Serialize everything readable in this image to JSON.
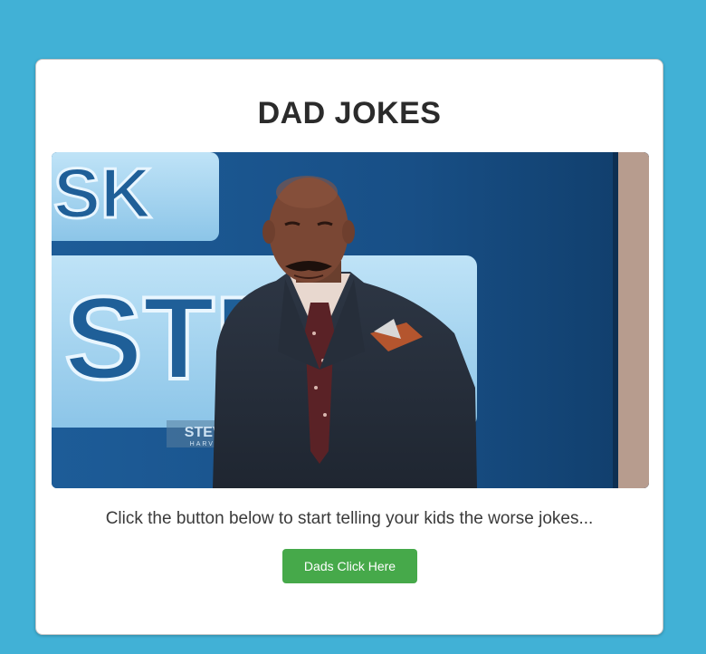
{
  "card": {
    "title": "DAD JOKES",
    "gif": {
      "alt": "Steve Harvey looking down with a grimace on the set of Ask Steve",
      "backdrop_letters_top": "SK",
      "backdrop_letters_middle": "STE",
      "show_logo_main": "STEVE",
      "show_logo_sub": "HARVEY"
    },
    "caption": "Click the button below to start telling your kids the worse jokes...",
    "button_label": "Dads Click Here"
  },
  "colors": {
    "page_background": "#41b1d6",
    "button": "#46a94a",
    "title": "#2b2b2b"
  }
}
